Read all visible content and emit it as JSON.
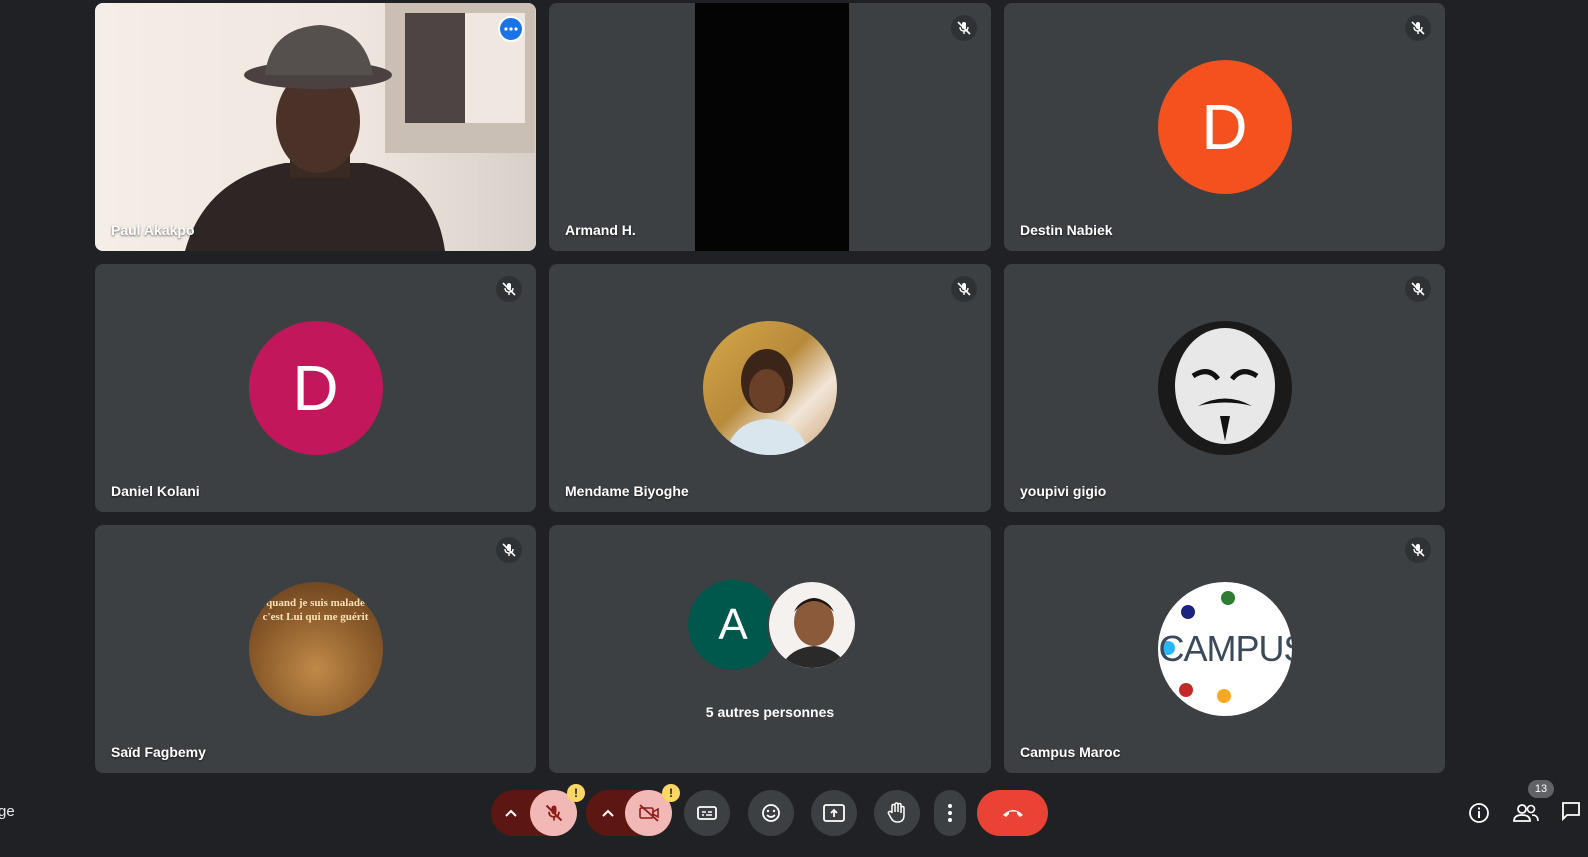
{
  "participants": [
    {
      "name": "Paul Akakpo"
    },
    {
      "name": "Armand H."
    },
    {
      "name": "Destin Nabiek",
      "initial": "D",
      "color": "#f4511e"
    },
    {
      "name": "Daniel Kolani",
      "initial": "D",
      "color": "#c2185b"
    },
    {
      "name": "Mendame Biyoghe"
    },
    {
      "name": "youpivi gigio"
    },
    {
      "name": "Saïd Fagbemy",
      "avatar_text": "quand je suis malade c'est Lui qui me guérit"
    },
    {
      "initial": "A",
      "color": "#00574b",
      "others_label": "5 autres personnes"
    },
    {
      "name": "Campus Maroc",
      "logo_text": "CAMPUS"
    }
  ],
  "controls": {
    "warn_mark": "!",
    "people_count": "13",
    "left_edge_text": "ge"
  },
  "colors": {
    "background": "#202124",
    "tile": "#3c4043",
    "end_call": "#ea4335",
    "mic_off": "#f9b9b4",
    "mic_off_dark": "#8c1d18",
    "active_border": "#8ab4f8"
  }
}
